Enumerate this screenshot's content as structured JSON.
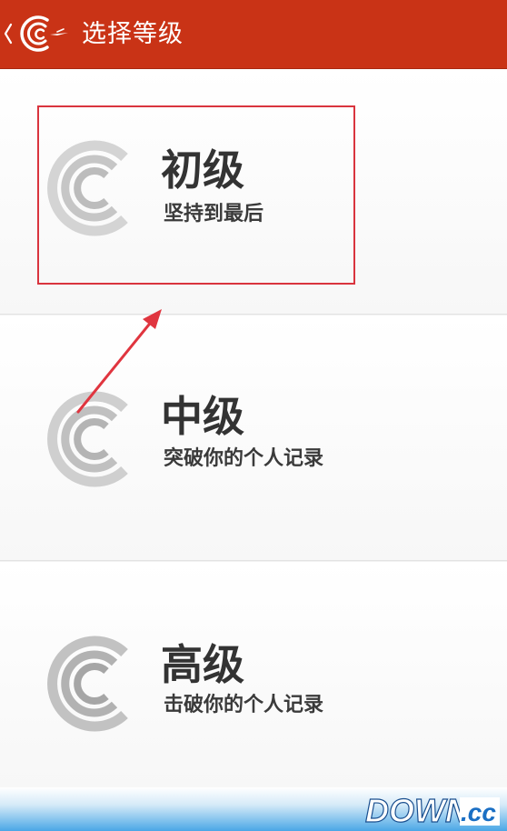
{
  "header": {
    "title": "选择等级",
    "back_icon": "chevron-left-icon",
    "logo_icon": "app-logo-icon"
  },
  "levels": [
    {
      "name": "初级",
      "desc": "坚持到最后",
      "icon": "level-c-icon"
    },
    {
      "name": "中级",
      "desc": "突破你的个人记录",
      "icon": "level-c-icon"
    },
    {
      "name": "高级",
      "desc": "击破你的个人记录",
      "icon": "level-c-icon"
    }
  ],
  "watermark": {
    "text": "DOWN",
    "suffix": ".cc"
  },
  "colors": {
    "accent": "#c93316",
    "highlight": "#d9343e",
    "icon_gray": "#b8b8b8",
    "watermark_blue": "#1a6fc4"
  }
}
